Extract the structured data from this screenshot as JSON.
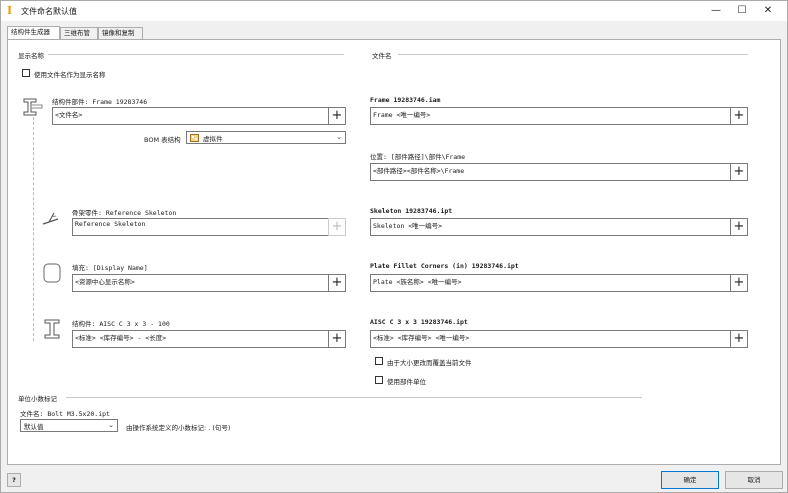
{
  "window": {
    "title": "文件命名默认值",
    "min": "—",
    "max": "☐",
    "close": "✕"
  },
  "tabs": [
    "结构件生成器",
    "三维布管",
    "镜像和复制"
  ],
  "left": {
    "section_label": "显示名称",
    "use_filename_checkbox": "使用文件名作为显示名称",
    "frame_label": "结构件部件: Frame 19283746",
    "frame_value": "<文件名>",
    "bom_label": "BOM 表结构",
    "bom_value": "虚拟件",
    "skeleton_label": "骨架零件: Reference Skeleton",
    "skeleton_value": "Reference Skeleton",
    "plate_label": "填充: [Display Name]",
    "plate_value": "<资源中心显示名称>",
    "member_label": "结构件: AISC C 3 x 3 - 100",
    "member_value": "<标准> <库存编号> - <长度>"
  },
  "right": {
    "section_label": "文件名",
    "frame_label": "Frame 19283746.iam",
    "frame_value": "Frame <唯一编号>",
    "location_label": "位置: [部件路径]\\部件\\Frame",
    "location_value": "<部件路径><部件名称>\\Frame",
    "skeleton_label": "Skeleton 19283746.ipt",
    "skeleton_value": "Skeleton <唯一编号>",
    "plate_label": "Plate Fillet Corners (in) 19283746.ipt",
    "plate_value": "Plate <族名称> <唯一编号>",
    "member_label": "AISC C 3 x 3 19283746.ipt",
    "member_value": "<标准> <库存编号> <唯一编号>",
    "overwrite_checkbox": "由于大小更改而覆盖当前文件",
    "use_units_checkbox": "使用部件单位"
  },
  "decimal": {
    "section_label": "单位小数标记",
    "filename_label": "文件名: Bolt M3.5x20.ipt",
    "combo_value": "默认值",
    "note": "由操作系统定义的小数标记: . (句号)"
  },
  "footer": {
    "help": "?",
    "ok": "确定",
    "cancel": "取消"
  },
  "plus": "+"
}
